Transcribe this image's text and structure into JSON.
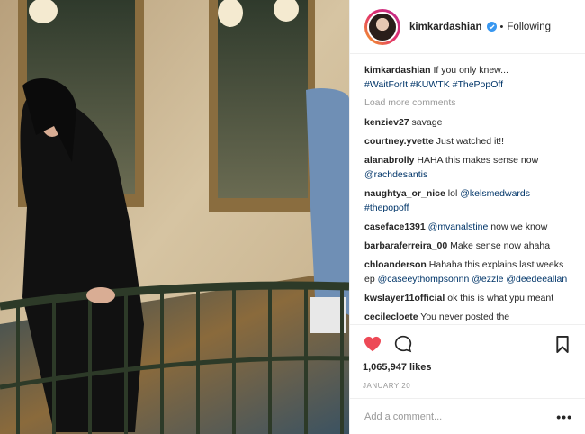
{
  "header": {
    "username": "kimkardashian",
    "separator": "•",
    "follow_status": "Following"
  },
  "caption": {
    "username": "kimkardashian",
    "text": "If you only knew...",
    "hashtags": "#WaitForIt #KUWTK #ThePopOff"
  },
  "load_more": "Load more comments",
  "comments": [
    {
      "user": "kenziev27",
      "text": "savage",
      "link": ""
    },
    {
      "user": "courtney.yvette",
      "text": "Just watched it!!",
      "link": ""
    },
    {
      "user": "alanabrolly",
      "text": "HAHA this makes sense now",
      "link": "@rachdesantis"
    },
    {
      "user": "naughtya_or_nice",
      "text": "lol",
      "link": "@kelsmedwards #thepopoff"
    },
    {
      "user": "caseface1391",
      "text": "",
      "link": "@mvanalstine",
      "after": "now we know"
    },
    {
      "user": "barbaraferreira_00",
      "text": "Make sense now ahaha",
      "link": ""
    },
    {
      "user": "chloanderson",
      "text": "Hahaha this explains last weeks ep",
      "link": "@caseeythompsonnn @ezzle @deedeeallan"
    },
    {
      "user": "kwslayer11official",
      "text": "ok this is what ypu meant",
      "link": ""
    },
    {
      "user": "cecilecloete",
      "text": "You never posted the",
      "link": ""
    }
  ],
  "likes": "1,065,947 likes",
  "date": "JANUARY 20",
  "add_comment_placeholder": "Add a comment...",
  "more_label": "•••",
  "icons": {
    "like": "heart-icon",
    "comment": "comment-icon",
    "save": "bookmark-icon",
    "verified": "verified-badge-icon"
  },
  "colors": {
    "heart": "#ed4956",
    "link": "#003569",
    "verified": "#3897f0",
    "muted": "#999999"
  }
}
